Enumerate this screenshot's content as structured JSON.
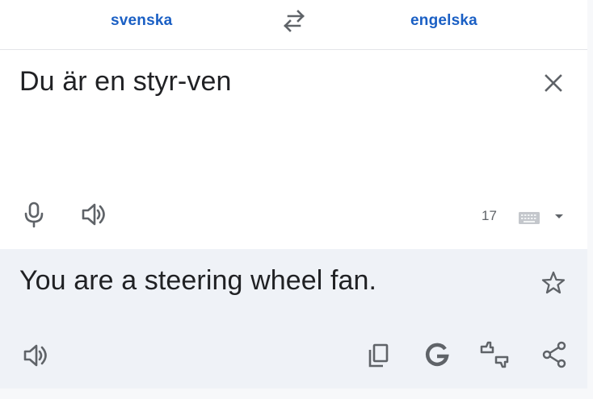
{
  "languages": {
    "source": "svenska",
    "target": "engelska"
  },
  "source": {
    "text": "Du är en styr-ven",
    "char_count": "17"
  },
  "target": {
    "text": "You are a steering wheel fan."
  },
  "icons": {
    "swap": "swap-arrows-icon",
    "clear": "close-icon",
    "mic": "microphone-icon",
    "speak": "speaker-icon",
    "keyboard": "keyboard-icon",
    "dropdown": "caret-down-icon",
    "star": "star-icon",
    "copy": "copy-icon",
    "google": "google-g-icon",
    "feedback": "feedback-icon",
    "share": "share-icon"
  },
  "colors": {
    "accent": "#1a5fc4",
    "icon": "#5f6368",
    "text": "#202124",
    "target_bg": "#eff2f7"
  }
}
